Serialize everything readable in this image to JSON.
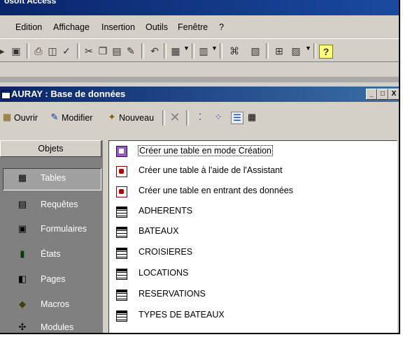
{
  "app": {
    "title_fragment": "osoft Access"
  },
  "menu": [
    "Edition",
    "Affichage",
    "Insertion",
    "Outils",
    "Fenêtre",
    "?"
  ],
  "toolbar": {
    "icons": [
      "run-icon",
      "save-icon",
      "print-icon",
      "print-preview-icon",
      "spelling-icon",
      "cut-icon",
      "copy-icon",
      "paste-icon",
      "format-painter-icon",
      "undo-icon",
      "office-links-icon",
      "analyze-icon",
      "code-icon",
      "properties-icon",
      "relationships-icon",
      "new-object-icon",
      "help-icon"
    ]
  },
  "db_window": {
    "title": "AURAY : Base de données",
    "buttons": {
      "open": "Ouvrir",
      "design": "Modifier",
      "new": "Nouveau"
    },
    "window_controls": [
      "_",
      "□",
      "X"
    ]
  },
  "sidebar": {
    "header": "Objets",
    "items": [
      {
        "label": "Tables",
        "icon": "table-icon",
        "selected": true
      },
      {
        "label": "Requêtes",
        "icon": "query-icon"
      },
      {
        "label": "Formulaires",
        "icon": "form-icon"
      },
      {
        "label": "États",
        "icon": "report-icon"
      },
      {
        "label": "Pages",
        "icon": "page-icon"
      },
      {
        "label": "Macros",
        "icon": "macro-icon"
      },
      {
        "label": "Modules",
        "icon": "module-icon"
      }
    ]
  },
  "objects": [
    {
      "label": "Créer une table en mode Création",
      "kind": "design",
      "selected": true
    },
    {
      "label": "Créer une table à l'aide de l'Assistant",
      "kind": "wizard"
    },
    {
      "label": "Créer une table en entrant des données",
      "kind": "wizard"
    },
    {
      "label": "ADHERENTS",
      "kind": "table"
    },
    {
      "label": "BATEAUX",
      "kind": "table"
    },
    {
      "label": "CROISIERES",
      "kind": "table"
    },
    {
      "label": "LOCATIONS",
      "kind": "table"
    },
    {
      "label": "RESERVATIONS",
      "kind": "table"
    },
    {
      "label": "TYPES DE BATEAUX",
      "kind": "table"
    }
  ]
}
